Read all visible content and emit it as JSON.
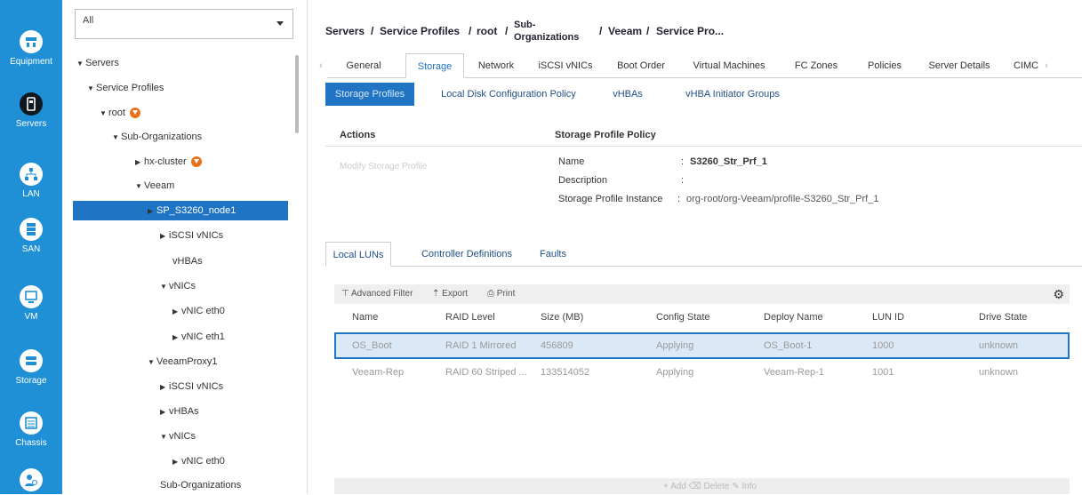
{
  "nav": [
    {
      "label": "Equipment",
      "icon": "equipment-icon",
      "active": false
    },
    {
      "label": "Servers",
      "icon": "server-icon",
      "active": true
    },
    {
      "label": "LAN",
      "icon": "lan-icon",
      "active": false
    },
    {
      "label": "SAN",
      "icon": "san-icon",
      "active": false
    },
    {
      "label": "VM",
      "icon": "vm-icon",
      "active": false
    },
    {
      "label": "Storage",
      "icon": "storage-icon",
      "active": false
    },
    {
      "label": "Chassis",
      "icon": "chassis-icon",
      "active": false
    },
    {
      "label": "",
      "icon": "admin-icon",
      "active": false
    }
  ],
  "tree": {
    "filter_value": "All",
    "nodes": [
      {
        "label": "Servers",
        "level": 0,
        "caret": "down",
        "badge": false,
        "selected": false
      },
      {
        "label": "Service Profiles",
        "level": 1,
        "caret": "down",
        "badge": false,
        "selected": false
      },
      {
        "label": "root",
        "level": 2,
        "caret": "down",
        "badge": true,
        "selected": false
      },
      {
        "label": "Sub-Organizations",
        "level": 3,
        "caret": "down",
        "badge": false,
        "selected": false
      },
      {
        "label": "hx-cluster",
        "level": 4,
        "caret": "right",
        "badge": true,
        "selected": false
      },
      {
        "label": "Veeam",
        "level": 4,
        "caret": "down",
        "badge": false,
        "selected": false
      },
      {
        "label": "SP_S3260_node1",
        "level": 5,
        "caret": "right",
        "badge": false,
        "selected": true
      },
      {
        "label": "iSCSI vNICs",
        "level": 6,
        "caret": "right",
        "badge": false,
        "selected": false
      },
      {
        "label": "vHBAs",
        "level": 6,
        "caret": "",
        "badge": false,
        "selected": false
      },
      {
        "label": "vNICs",
        "level": 6,
        "caret": "down",
        "badge": false,
        "selected": false
      },
      {
        "label": "vNIC eth0",
        "level": 7,
        "caret": "right",
        "badge": false,
        "selected": false
      },
      {
        "label": "vNIC eth1",
        "level": 7,
        "caret": "right",
        "badge": false,
        "selected": false
      },
      {
        "label": "VeeamProxy1",
        "level": 5,
        "caret": "down",
        "badge": false,
        "selected": false
      },
      {
        "label": "iSCSI vNICs",
        "level": 6,
        "caret": "right",
        "badge": false,
        "selected": false
      },
      {
        "label": "vHBAs",
        "level": 6,
        "caret": "right",
        "badge": false,
        "selected": false
      },
      {
        "label": "vNICs",
        "level": 6,
        "caret": "down",
        "badge": false,
        "selected": false
      },
      {
        "label": "vNIC eth0",
        "level": 7,
        "caret": "right",
        "badge": false,
        "selected": false
      },
      {
        "label": "Sub-Organizations",
        "level": 6,
        "caret": "",
        "badge": false,
        "selected": false
      }
    ]
  },
  "breadcrumb": {
    "servers": "Servers",
    "service_profiles": "Service Profiles",
    "root": "root",
    "sub_org_1": "Sub-",
    "sub_org_2": "Organizations",
    "veeam": "Veeam",
    "service_pro": "Service Pro...",
    "sep": "/"
  },
  "tabs": [
    "General",
    "Storage",
    "Network",
    "iSCSI vNICs",
    "Boot Order",
    "Virtual Machines",
    "FC Zones",
    "Policies",
    "Server Details",
    "CIMC"
  ],
  "tabs_active": "Storage",
  "tabs_scroll_left": "‹",
  "tabs_scroll_right": "›",
  "subtabs": [
    "Storage Profiles",
    "Local Disk Configuration Policy",
    "vHBAs",
    "vHBA Initiator Groups"
  ],
  "actions": {
    "heading": "Actions",
    "modify_label": "Modify Storage Profile"
  },
  "policy": {
    "heading": "Storage Profile Policy",
    "name_label": "Name",
    "name_value": "S3260_Str_Prf_1",
    "desc_label": "Description",
    "desc_value": "",
    "instance_label": "Storage Profile Instance",
    "instance_value": "org-root/org-Veeam/profile-S3260_Str_Prf_1",
    "colon": ":"
  },
  "lower_tabs": [
    "Local LUNs",
    "Controller Definitions",
    "Faults"
  ],
  "toolbar": {
    "filter": "Advanced Filter",
    "export": "Export",
    "print": "Print"
  },
  "table": {
    "columns": [
      "Name",
      "RAID Level",
      "Size (MB)",
      "Config State",
      "Deploy Name",
      "LUN ID",
      "Drive State"
    ],
    "rows": [
      [
        "OS_Boot",
        "RAID 1 Mirrored",
        "456809",
        "Applying",
        "OS_Boot-1",
        "1000",
        "unknown"
      ],
      [
        "Veeam-Rep",
        "RAID 60 Striped ...",
        "133514052",
        "Applying",
        "Veeam-Rep-1",
        "1001",
        "unknown"
      ]
    ],
    "selected_row": 0
  },
  "footer_text": "+ Add  ⌫ Delete  ✎ Info"
}
